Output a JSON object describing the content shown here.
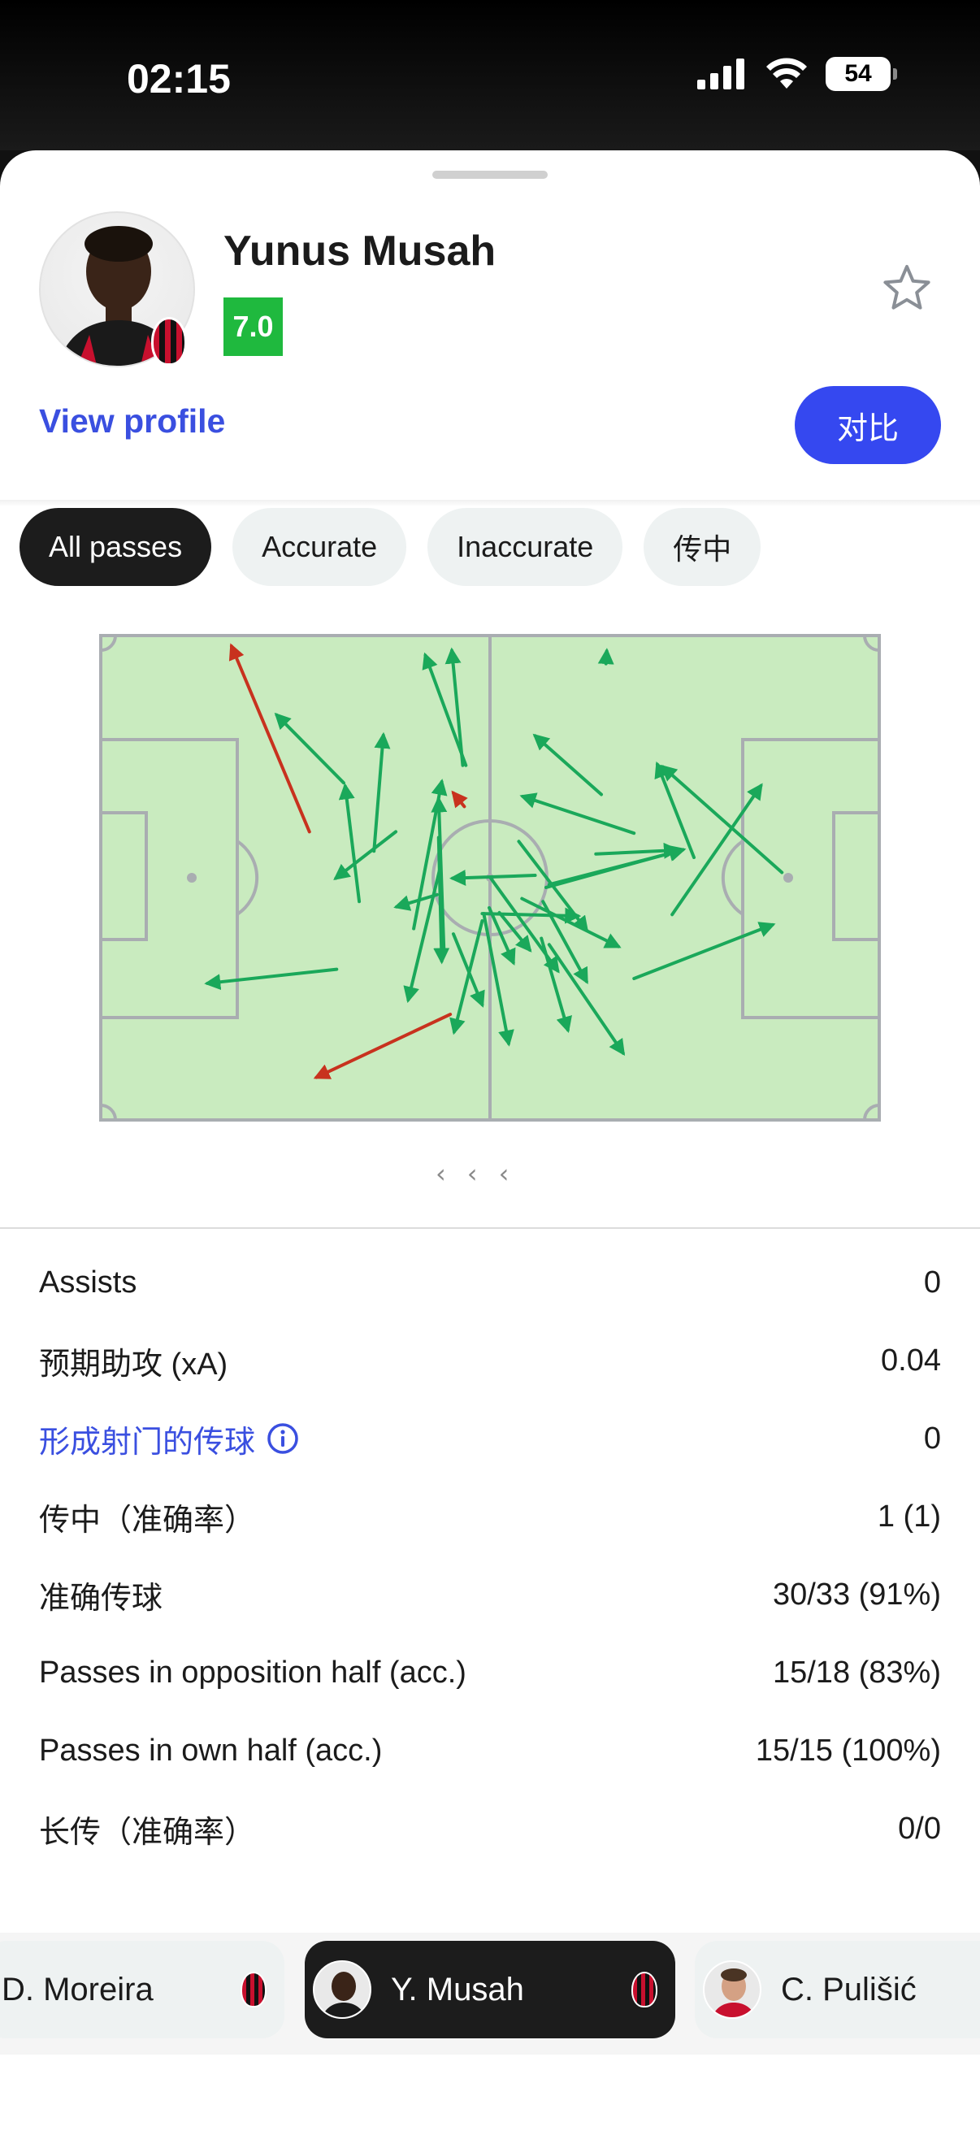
{
  "status_bar": {
    "time": "02:15",
    "battery": "54"
  },
  "player": {
    "name": "Yunus Musah",
    "rating": "7.0",
    "view_profile_label": "View profile",
    "compare_label": "对比"
  },
  "filters": [
    {
      "label": "All passes",
      "active": true
    },
    {
      "label": "Accurate",
      "active": false
    },
    {
      "label": "Inaccurate",
      "active": false
    },
    {
      "label": "传中",
      "active": false
    }
  ],
  "pass_map": {
    "colors": {
      "accurate": "#1aa85a",
      "inaccurate": "#c8321e",
      "pitch": "#c9ebbf",
      "lines": "#a9adb1"
    },
    "passes": [
      {
        "from": [
          0.268,
          0.405
        ],
        "to": [
          0.168,
          0.022
        ],
        "accurate": false
      },
      {
        "from": [
          0.449,
          0.782
        ],
        "to": [
          0.277,
          0.912
        ],
        "accurate": false
      },
      {
        "from": [
          0.467,
          0.353
        ],
        "to": [
          0.453,
          0.325
        ],
        "accurate": false
      },
      {
        "from": [
          0.312,
          0.304
        ],
        "to": [
          0.226,
          0.164
        ],
        "accurate": true
      },
      {
        "from": [
          0.332,
          0.549
        ],
        "to": [
          0.314,
          0.311
        ],
        "accurate": true
      },
      {
        "from": [
          0.351,
          0.445
        ],
        "to": [
          0.363,
          0.206
        ],
        "accurate": true
      },
      {
        "from": [
          0.379,
          0.405
        ],
        "to": [
          0.302,
          0.501
        ],
        "accurate": true
      },
      {
        "from": [
          0.469,
          0.268
        ],
        "to": [
          0.417,
          0.041
        ],
        "accurate": true
      },
      {
        "from": [
          0.465,
          0.268
        ],
        "to": [
          0.451,
          0.031
        ],
        "accurate": true
      },
      {
        "from": [
          0.434,
          0.417
        ],
        "to": [
          0.438,
          0.672
        ],
        "accurate": true
      },
      {
        "from": [
          0.436,
          0.479
        ],
        "to": [
          0.395,
          0.752
        ],
        "accurate": true
      },
      {
        "from": [
          0.432,
          0.535
        ],
        "to": [
          0.38,
          0.56
        ],
        "accurate": true
      },
      {
        "from": [
          0.402,
          0.605
        ],
        "to": [
          0.438,
          0.302
        ],
        "accurate": true
      },
      {
        "from": [
          0.441,
          0.658
        ],
        "to": [
          0.434,
          0.338
        ],
        "accurate": true
      },
      {
        "from": [
          0.453,
          0.616
        ],
        "to": [
          0.49,
          0.762
        ],
        "accurate": true
      },
      {
        "from": [
          0.49,
          0.589
        ],
        "to": [
          0.454,
          0.818
        ],
        "accurate": true
      },
      {
        "from": [
          0.49,
          0.574
        ],
        "to": [
          0.613,
          0.579
        ],
        "accurate": true
      },
      {
        "from": [
          0.492,
          0.574
        ],
        "to": [
          0.524,
          0.842
        ],
        "accurate": true
      },
      {
        "from": [
          0.499,
          0.562
        ],
        "to": [
          0.53,
          0.675
        ],
        "accurate": true
      },
      {
        "from": [
          0.501,
          0.501
        ],
        "to": [
          0.587,
          0.692
        ],
        "accurate": true
      },
      {
        "from": [
          0.512,
          0.572
        ],
        "to": [
          0.551,
          0.649
        ],
        "accurate": true
      },
      {
        "from": [
          0.558,
          0.495
        ],
        "to": [
          0.452,
          0.501
        ],
        "accurate": true
      },
      {
        "from": [
          0.568,
          0.549
        ],
        "to": [
          0.624,
          0.714
        ],
        "accurate": true
      },
      {
        "from": [
          0.537,
          0.425
        ],
        "to": [
          0.624,
          0.608
        ],
        "accurate": true
      },
      {
        "from": [
          0.541,
          0.543
        ],
        "to": [
          0.665,
          0.642
        ],
        "accurate": true
      },
      {
        "from": [
          0.566,
          0.625
        ],
        "to": [
          0.6,
          0.814
        ],
        "accurate": true
      },
      {
        "from": [
          0.576,
          0.638
        ],
        "to": [
          0.671,
          0.862
        ],
        "accurate": true
      },
      {
        "from": [
          0.572,
          0.52
        ],
        "to": [
          0.748,
          0.442
        ],
        "accurate": true
      },
      {
        "from": [
          0.576,
          0.514
        ],
        "to": [
          0.747,
          0.443
        ],
        "accurate": true
      },
      {
        "from": [
          0.685,
          0.408
        ],
        "to": [
          0.542,
          0.332
        ],
        "accurate": true
      },
      {
        "from": [
          0.643,
          0.328
        ],
        "to": [
          0.558,
          0.207
        ],
        "accurate": true
      },
      {
        "from": [
          0.636,
          0.451
        ],
        "to": [
          0.74,
          0.443
        ],
        "accurate": true
      },
      {
        "from": [
          0.649,
          0.058
        ],
        "to": [
          0.65,
          0.032
        ],
        "accurate": true
      },
      {
        "from": [
          0.762,
          0.458
        ],
        "to": [
          0.715,
          0.266
        ],
        "accurate": true
      },
      {
        "from": [
          0.875,
          0.489
        ],
        "to": [
          0.722,
          0.271
        ],
        "accurate": true
      },
      {
        "from": [
          0.734,
          0.576
        ],
        "to": [
          0.848,
          0.31
        ],
        "accurate": true
      },
      {
        "from": [
          0.685,
          0.708
        ],
        "to": [
          0.863,
          0.597
        ],
        "accurate": true
      },
      {
        "from": [
          0.303,
          0.689
        ],
        "to": [
          0.137,
          0.718
        ],
        "accurate": true
      }
    ]
  },
  "pager_glyph": "‹",
  "stats": [
    {
      "label": "Assists",
      "value": "0",
      "link": false
    },
    {
      "label": "预期助攻 (xA)",
      "value": "0.04",
      "link": false
    },
    {
      "label": "形成射门的传球",
      "value": "0",
      "link": true
    },
    {
      "label": "传中（准确率）",
      "value": "1 (1)",
      "link": false
    },
    {
      "label": "准确传球",
      "value": "30/33 (91%)",
      "link": false
    },
    {
      "label": "Passes in opposition half (acc.)",
      "value": "15/18 (83%)",
      "link": false
    },
    {
      "label": "Passes in own half (acc.)",
      "value": "15/15 (100%)",
      "link": false
    },
    {
      "label": "长传（准确率）",
      "value": "0/0",
      "link": false
    }
  ],
  "switcher": [
    {
      "name": "D. Moreira",
      "active": false
    },
    {
      "name": "Y. Musah",
      "active": true
    },
    {
      "name": "C. Pulišić",
      "active": false
    }
  ]
}
